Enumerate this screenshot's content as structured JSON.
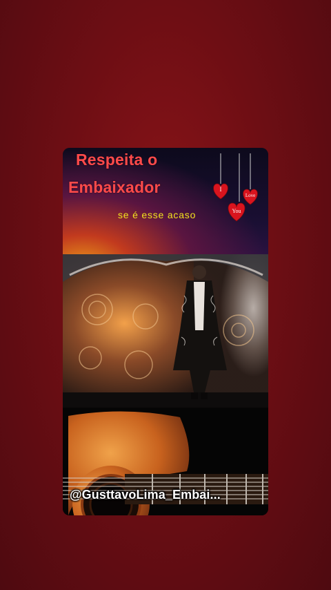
{
  "card": {
    "title_line1": "Respeita o",
    "title_line2": "Embaixador",
    "lyric": "se é esse acaso",
    "handle": "@GusttavoLima_Embai...",
    "hearts": {
      "word1": "I",
      "word2": "Love",
      "word3": "You",
      "color": "#d9141e"
    },
    "icons": [
      "heart-icon",
      "heart-icon",
      "heart-icon",
      "guitar-illustration",
      "stage-performer-image"
    ]
  },
  "colors": {
    "background": "#6e0e14",
    "title": "#ff4a4a",
    "lyric": "#f2e21e",
    "handle": "#ffffff"
  }
}
